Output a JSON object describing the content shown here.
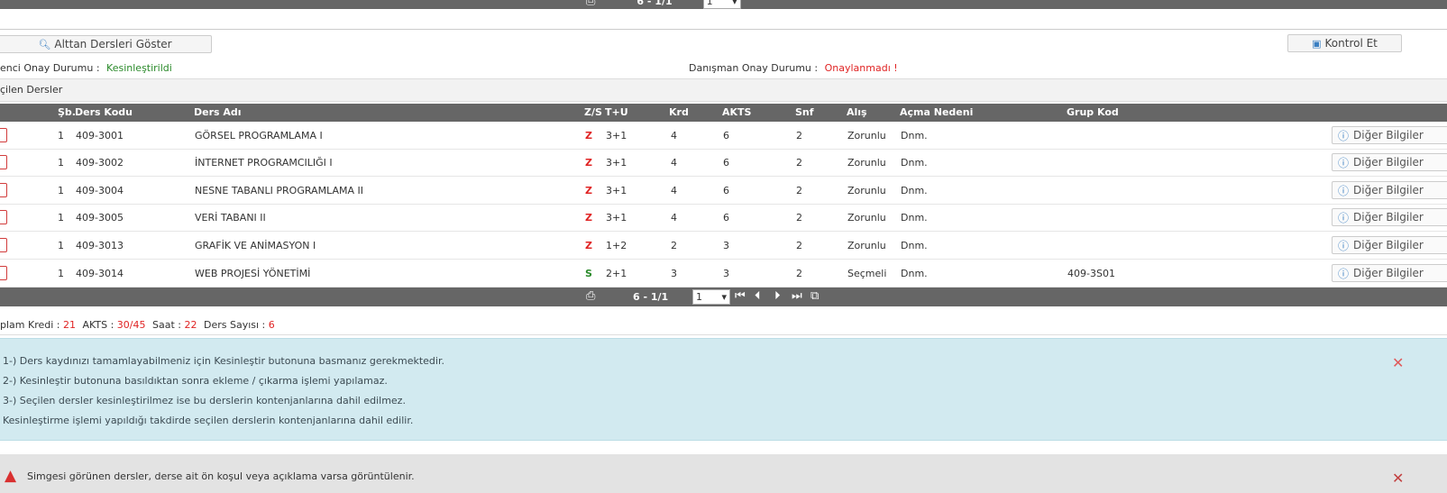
{
  "pager": {
    "print_icon": "printer-icon",
    "page_info": "6 - 1/1",
    "page_select": "1",
    "nav_first": "⏮",
    "nav_prev": "⏴",
    "nav_next": "⏵",
    "nav_last": "⏭",
    "copy_icon": "⧉"
  },
  "toolbar": {
    "show_lower_label": "Alttan Dersleri Göster",
    "check_label": "Kontrol Et"
  },
  "status": {
    "student_label": "enci Onay Durumu :",
    "student_value": "Kesinleştirildi",
    "advisor_label": "Danışman Onay Durumu :",
    "advisor_value": "Onaylanmadı !"
  },
  "section_title": "çilen Dersler",
  "table": {
    "headers": {
      "sb": "Şb.",
      "kod": "Ders Kodu",
      "ad": "Ders Adı",
      "zs": "Z/S",
      "tu": "T+U",
      "krd": "Krd",
      "akts": "AKTS",
      "snf": "Snf",
      "alis": "Alış",
      "acma": "Açma Nedeni",
      "grup": "Grup Kod"
    },
    "rows": [
      {
        "sb": "1",
        "kod": "409-3001",
        "ad": "GÖRSEL PROGRAMLAMA I",
        "zs": "Z",
        "tu": "3+1",
        "krd": "4",
        "akts": "6",
        "snf": "2",
        "alis": "Zorunlu",
        "acma": "Dnm.",
        "grup": "",
        "action": "Diğer Bilgiler"
      },
      {
        "sb": "1",
        "kod": "409-3002",
        "ad": "İNTERNET PROGRAMCILIĞI I",
        "zs": "Z",
        "tu": "3+1",
        "krd": "4",
        "akts": "6",
        "snf": "2",
        "alis": "Zorunlu",
        "acma": "Dnm.",
        "grup": "",
        "action": "Diğer Bilgiler"
      },
      {
        "sb": "1",
        "kod": "409-3004",
        "ad": "NESNE TABANLI PROGRAMLAMA II",
        "zs": "Z",
        "tu": "3+1",
        "krd": "4",
        "akts": "6",
        "snf": "2",
        "alis": "Zorunlu",
        "acma": "Dnm.",
        "grup": "",
        "action": "Diğer Bilgiler"
      },
      {
        "sb": "1",
        "kod": "409-3005",
        "ad": "VERİ TABANI II",
        "zs": "Z",
        "tu": "3+1",
        "krd": "4",
        "akts": "6",
        "snf": "2",
        "alis": "Zorunlu",
        "acma": "Dnm.",
        "grup": "",
        "action": "Diğer Bilgiler"
      },
      {
        "sb": "1",
        "kod": "409-3013",
        "ad": "GRAFİK VE ANİMASYON I",
        "zs": "Z",
        "tu": "1+2",
        "krd": "2",
        "akts": "3",
        "snf": "2",
        "alis": "Zorunlu",
        "acma": "Dnm.",
        "grup": "",
        "action": "Diğer Bilgiler"
      },
      {
        "sb": "1",
        "kod": "409-3014",
        "ad": "WEB PROJESİ YÖNETİMİ",
        "zs": "S",
        "tu": "2+1",
        "krd": "3",
        "akts": "3",
        "snf": "2",
        "alis": "Seçmeli",
        "acma": "Dnm.",
        "grup": "409-3S01",
        "action": "Diğer Bilgiler"
      }
    ]
  },
  "totals": {
    "kredi_label": "plam Kredi :",
    "kredi_value": "21",
    "akts_label": "AKTS :",
    "akts_value": "30/45",
    "saat_label": "Saat :",
    "saat_value": "22",
    "sayi_label": "Ders Sayısı :",
    "sayi_value": "6"
  },
  "info_alert": {
    "lines": [
      "1-) Ders kaydınızı tamamlayabilmeniz için Kesinleştir butonuna basmanız gerekmektedir.",
      "2-) Kesinleştir butonuna basıldıktan sonra ekleme / çıkarma işlemi yapılamaz.",
      "3-) Seçilen dersler kesinleştirilmez ise bu derslerin kontenjanlarına dahil edilmez.",
      "Kesinleştirme işlemi yapıldığı takdirde seçilen derslerin kontenjanlarına dahil edilir."
    ]
  },
  "warn_alert": {
    "text": "Simgesi görünen dersler, derse ait ön koşul veya açıklama varsa görüntülenir."
  },
  "colors": {
    "bar": "#666666",
    "green": "#2a8a2a",
    "red": "#e02424",
    "info_bg": "#d2eaf0",
    "warn_bg": "#e3e3e3"
  }
}
